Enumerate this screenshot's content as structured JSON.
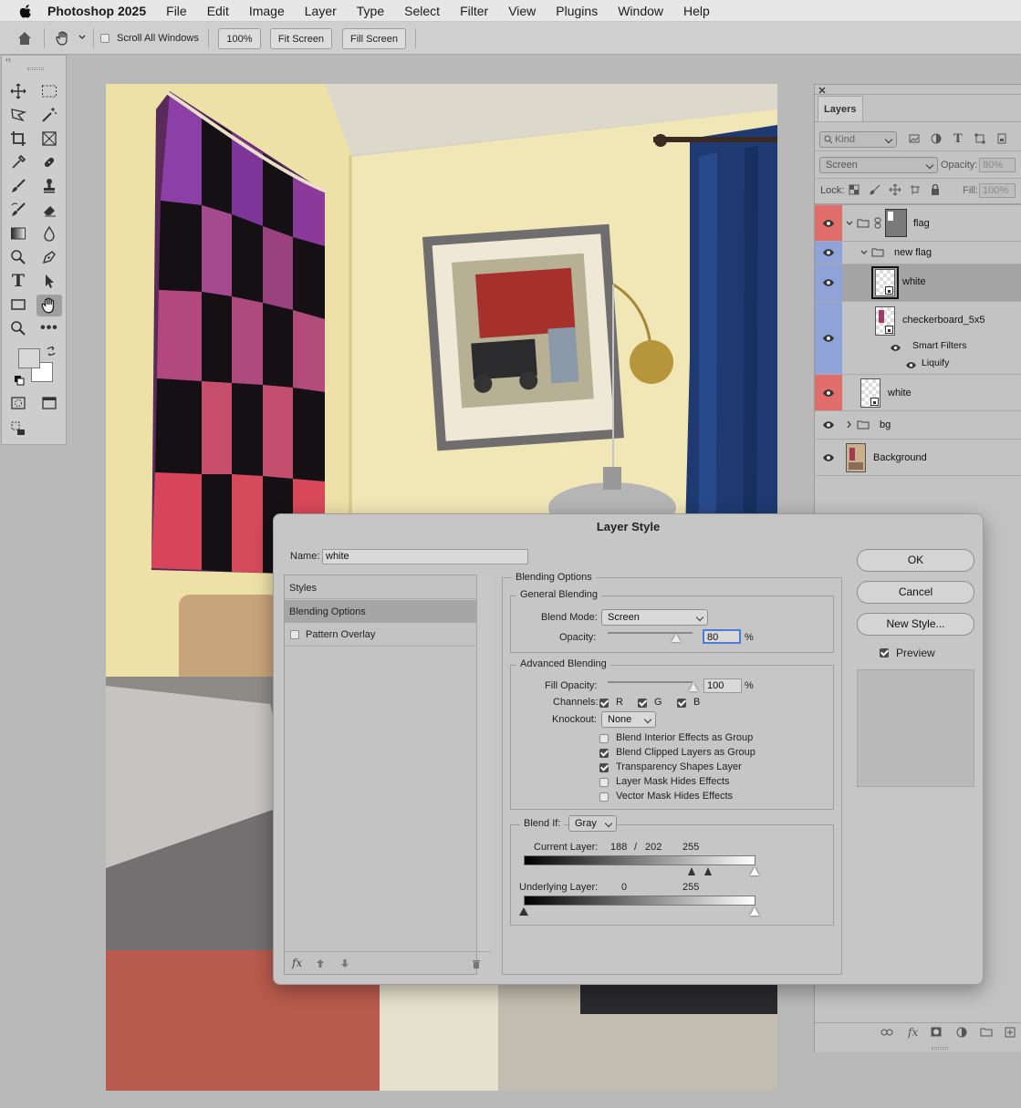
{
  "menubar": {
    "app_name": "Photoshop 2025",
    "items": [
      "File",
      "Edit",
      "Image",
      "Layer",
      "Type",
      "Select",
      "Filter",
      "View",
      "Plugins",
      "Window",
      "Help"
    ]
  },
  "options": {
    "scroll_all_windows": "Scroll All Windows",
    "zoom_100": "100%",
    "fit_screen": "Fit Screen",
    "fill_screen": "Fill Screen"
  },
  "layers_panel": {
    "tab": "Layers",
    "filter_kind": "Kind",
    "blend_mode": "Screen",
    "opacity_label": "Opacity:",
    "opacity_value": "80%",
    "lock_label": "Lock:",
    "fill_label": "Fill:",
    "fill_value": "100%",
    "layers": [
      {
        "name": "flag",
        "color": "#e06d6a",
        "kind": "group"
      },
      {
        "name": "new flag",
        "color": "#8fa3d9",
        "kind": "group"
      },
      {
        "name": "white",
        "color": "#8fa3d9",
        "kind": "smart"
      },
      {
        "name": "checkerboard_5x5",
        "color": "#8fa3d9",
        "kind": "smart"
      },
      {
        "name": "Smart Filters",
        "color": "#8fa3d9",
        "kind": "sub"
      },
      {
        "name": "Liquify",
        "color": "#8fa3d9",
        "kind": "sub"
      },
      {
        "name": "white",
        "color": "#e06d6a",
        "kind": "smart"
      },
      {
        "name": "bg",
        "color": "",
        "kind": "group"
      },
      {
        "name": "Background",
        "color": "",
        "kind": "image"
      }
    ]
  },
  "dialog": {
    "title": "Layer Style",
    "name_label": "Name:",
    "name_value": "white",
    "styles_header": "Styles",
    "styles_items": [
      "Blending Options",
      "Pattern Overlay"
    ],
    "buttons": {
      "ok": "OK",
      "cancel": "Cancel",
      "new_style": "New Style..."
    },
    "preview_label": "Preview",
    "blending_options": "Blending Options",
    "general_blending": "General Blending",
    "blend_mode_label": "Blend Mode:",
    "blend_mode_value": "Screen",
    "opacity_label": "Opacity:",
    "opacity_value": "80",
    "opacity_level": 80,
    "percent": "%",
    "advanced_blending": "Advanced Blending",
    "fill_opacity_label": "Fill Opacity:",
    "fill_opacity_value": "100",
    "fill_opacity_level": 100,
    "channels_label": "Channels:",
    "channels": [
      "R",
      "G",
      "B"
    ],
    "knockout_label": "Knockout:",
    "knockout_value": "None",
    "checkboxes": [
      {
        "label": "Blend Interior Effects as Group",
        "checked": false
      },
      {
        "label": "Blend Clipped Layers as Group",
        "checked": true
      },
      {
        "label": "Transparency Shapes Layer",
        "checked": true
      },
      {
        "label": "Layer Mask Hides Effects",
        "checked": false
      },
      {
        "label": "Vector Mask Hides Effects",
        "checked": false
      }
    ],
    "blend_if_label": "Blend If:",
    "blend_if_value": "Gray",
    "current_layer_label": "Current Layer:",
    "current_low": "188",
    "current_slash": "/",
    "current_mid": "202",
    "current_high": "255",
    "underlying_label": "Underlying Layer:",
    "underlying_low": "0",
    "underlying_high": "255",
    "fx_label": "fx"
  }
}
